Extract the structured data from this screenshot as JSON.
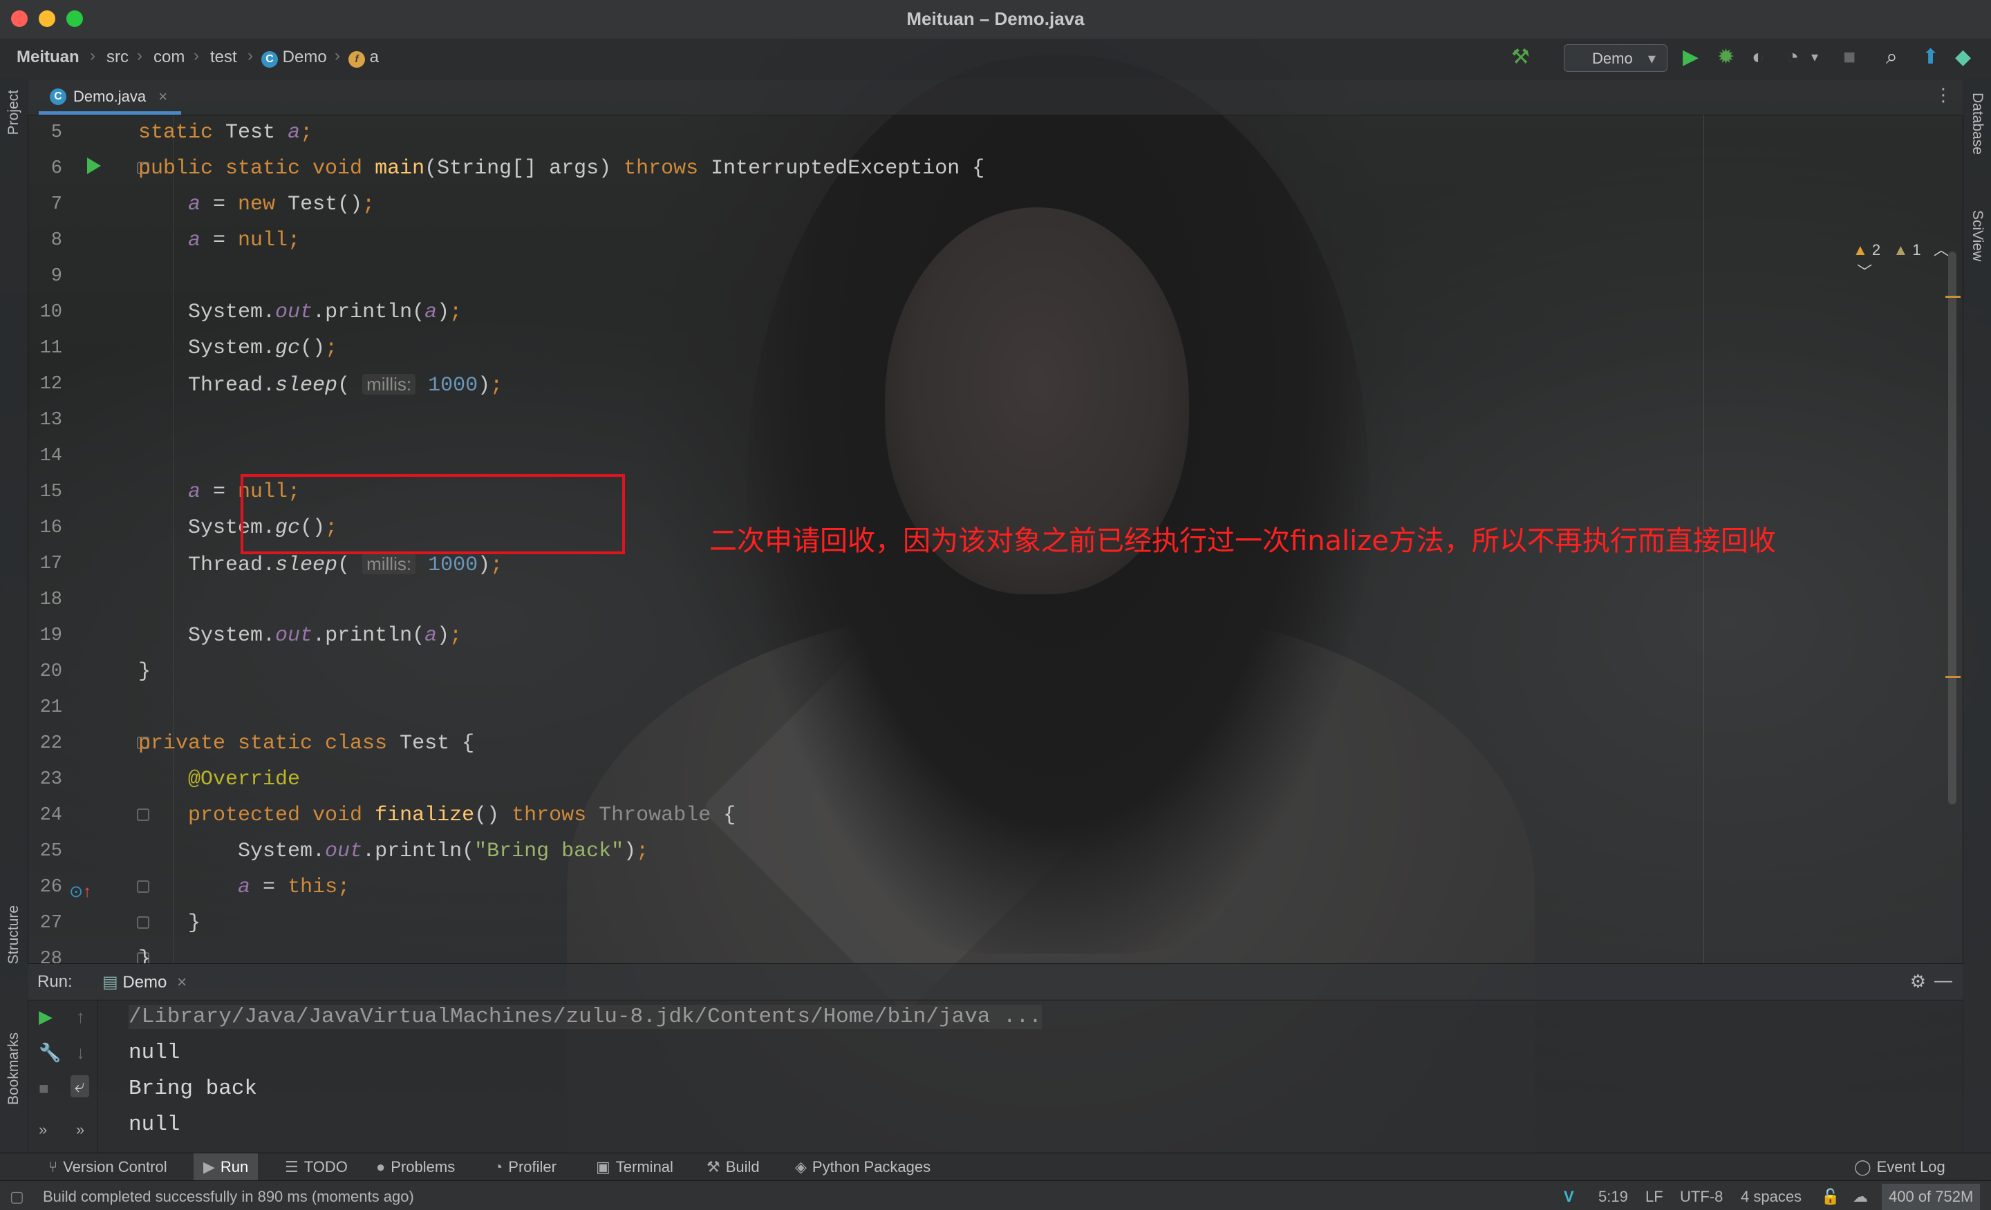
{
  "window": {
    "title": "Meituan – Demo.java"
  },
  "breadcrumb": {
    "project": "Meituan",
    "items": [
      "src",
      "com",
      "test",
      "Demo",
      "a"
    ]
  },
  "toolbar": {
    "run_config": "Demo"
  },
  "side": {
    "left_top": "Project",
    "left_mid": "Structure",
    "left_bottom": "Bookmarks",
    "right_top": "Database",
    "right_mid": "SciView"
  },
  "editor": {
    "tab": "Demo.java",
    "warnings": "2",
    "weak_warnings": "1",
    "line_numbers": [
      "5",
      "6",
      "7",
      "8",
      "9",
      "10",
      "11",
      "12",
      "13",
      "14",
      "15",
      "16",
      "17",
      "18",
      "19",
      "20",
      "21",
      "22",
      "23",
      "24",
      "25",
      "26",
      "27",
      "28"
    ],
    "annotation": "二次申请回收，因为该对象之前已经执行过一次finalize方法，所以不再执行而直接回收",
    "hint_label": "millis:"
  },
  "run": {
    "label": "Run:",
    "tab": "Demo",
    "output": [
      "/Library/Java/JavaVirtualMachines/zulu-8.jdk/Contents/Home/bin/java ...",
      "null",
      "Bring back",
      "null"
    ]
  },
  "tool_tabs": [
    "Version Control",
    "Run",
    "TODO",
    "Problems",
    "Profiler",
    "Terminal",
    "Build",
    "Python Packages"
  ],
  "event_log": "Event Log",
  "status": {
    "message": "Build completed successfully in 890 ms (moments ago)",
    "position": "5:19",
    "line_sep": "LF",
    "encoding": "UTF-8",
    "indent": "4 spaces",
    "memory": "400 of 752M"
  }
}
